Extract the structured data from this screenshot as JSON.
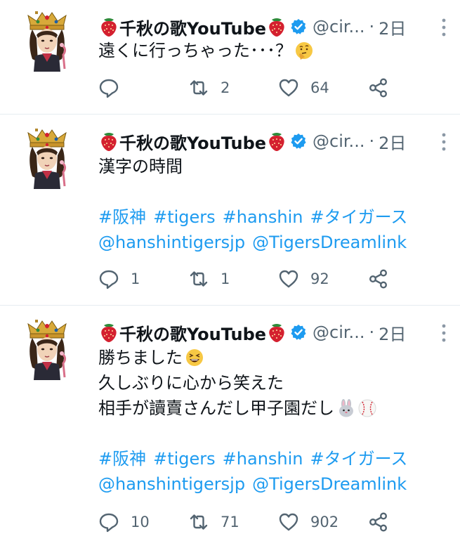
{
  "tweets": [
    {
      "author": "千秋の歌YouTube",
      "handle": "@cir...",
      "sep": "·",
      "time": "2日",
      "lines": [
        "遠くに行っちゃった･･･？"
      ],
      "emojis": [
        "thinking-face"
      ],
      "hashtags": [],
      "mentions": [],
      "replies": "",
      "retweets": "2",
      "likes": "64"
    },
    {
      "author": "千秋の歌YouTube",
      "handle": "@cir...",
      "sep": "·",
      "time": "2日",
      "lines": [
        "漢字の時間"
      ],
      "hashtags": [
        "#阪神",
        "#tigers",
        "#hanshin",
        "#タイガース"
      ],
      "mentions": [
        "@hanshintigersjp",
        "@TigersDreamlink"
      ],
      "replies": "1",
      "retweets": "1",
      "likes": "92"
    },
    {
      "author": "千秋の歌YouTube",
      "handle": "@cir...",
      "sep": "·",
      "time": "2日",
      "lines": [
        "勝ちました",
        "久しぶりに心から笑えた",
        "相手が讀賣さんだし甲子園だし"
      ],
      "emojis": [
        "grinning-squinting-face",
        "rabbit-face",
        "baseball"
      ],
      "hashtags": [
        "#阪神",
        "#tigers",
        "#hanshin",
        "#タイガース"
      ],
      "mentions": [
        "@hanshintigersjp",
        "@TigersDreamlink"
      ],
      "replies": "10",
      "retweets": "71",
      "likes": "902"
    }
  ],
  "colors": {
    "link": "#1d9bf0",
    "muted": "#536471",
    "verified": "#1d9bf0",
    "divider": "#e6ecf0"
  }
}
